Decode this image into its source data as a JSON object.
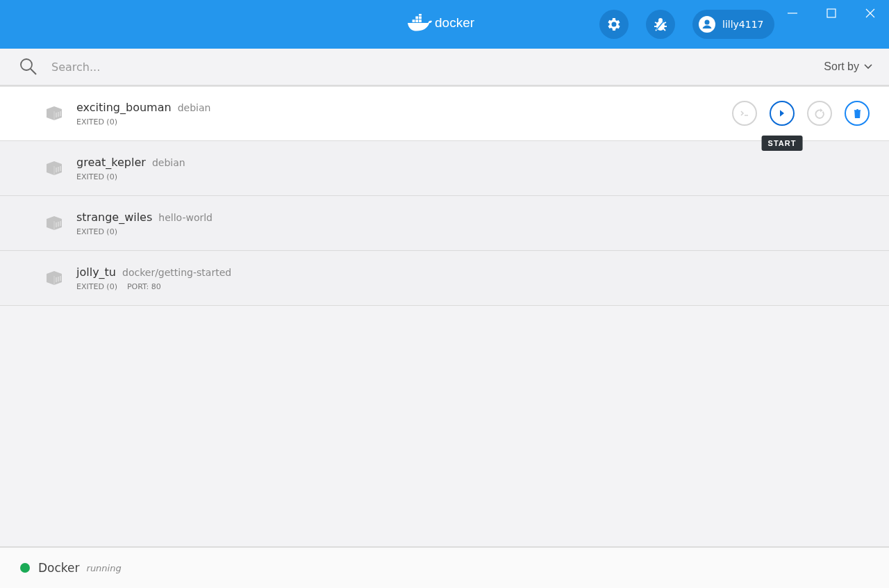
{
  "header": {
    "logo_text": "docker",
    "user": "lilly4117"
  },
  "search": {
    "placeholder": "Search...",
    "sort_label": "Sort by"
  },
  "containers": [
    {
      "name": "exciting_bouman",
      "image": "debian",
      "status": "EXITED (0)",
      "hovered": true,
      "actions": [
        {
          "kind": "cli",
          "disabled": true
        },
        {
          "kind": "start",
          "disabled": false,
          "tooltip": "START"
        },
        {
          "kind": "restart",
          "disabled": true
        },
        {
          "kind": "delete",
          "disabled": false
        }
      ]
    },
    {
      "name": "great_kepler",
      "image": "debian",
      "status": "EXITED (0)",
      "hovered": false
    },
    {
      "name": "strange_wiles",
      "image": "hello-world",
      "status": "EXITED (0)",
      "hovered": false
    },
    {
      "name": "jolly_tu",
      "image": "docker/getting-started",
      "status": "EXITED (0)",
      "port": "PORT: 80",
      "hovered": false
    }
  ],
  "status_bar": {
    "name": "Docker",
    "state": "running",
    "color": "#1aaa55"
  }
}
